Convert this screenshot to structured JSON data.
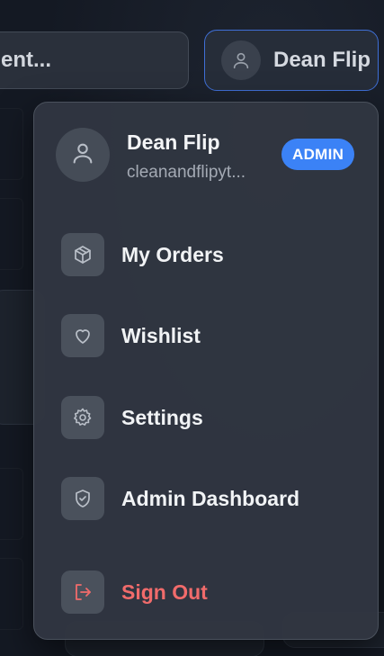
{
  "search": {
    "value": "ent..."
  },
  "user_pill": {
    "name": "Dean Flip",
    "avatar_icon": "user-icon"
  },
  "menu": {
    "header": {
      "name": "Dean Flip",
      "email": "cleanandflipyt...",
      "badge": "ADMIN",
      "avatar_icon": "user-icon"
    },
    "items": [
      {
        "label": "My Orders",
        "icon": "package-icon"
      },
      {
        "label": "Wishlist",
        "icon": "heart-icon"
      },
      {
        "label": "Settings",
        "icon": "gear-icon"
      },
      {
        "label": "Admin Dashboard",
        "icon": "shield-check-icon"
      },
      {
        "label": "Sign Out",
        "icon": "sign-out-icon"
      }
    ]
  },
  "colors": {
    "accent": "#3b82f6",
    "danger": "#f16b6b",
    "menu_bg": "#313641"
  }
}
